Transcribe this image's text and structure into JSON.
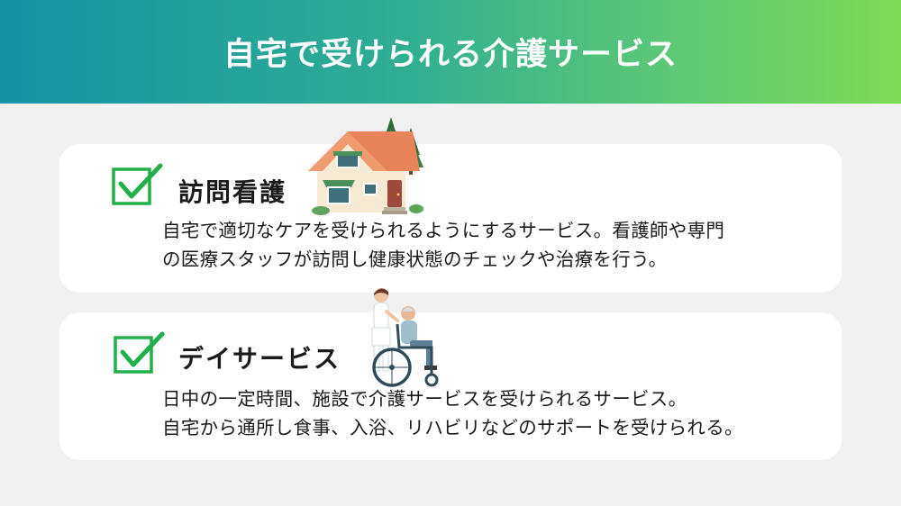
{
  "header": {
    "title": "自宅で受けられる介護サービス"
  },
  "services": [
    {
      "title": "訪問看護",
      "lines": [
        "自宅で適切なケアを受けられるようにするサービス。看護師や専門",
        "の医療スタッフが訪問し健康状態のチェックや治療を行う。"
      ],
      "icon": "checkbox-checked-icon",
      "illustration": "house-illustration"
    },
    {
      "title": "デイサービス",
      "lines": [
        "日中の一定時間、施設で介護サービスを受けられるサービス。",
        "自宅から通所し食事、入浴、リハビリなどのサポートを受けられる。"
      ],
      "icon": "checkbox-checked-icon",
      "illustration": "wheelchair-caregiver-illustration"
    }
  ],
  "colors": {
    "banner_start": "#1593a6",
    "banner_end": "#7ed957",
    "check_green": "#22b04b"
  }
}
